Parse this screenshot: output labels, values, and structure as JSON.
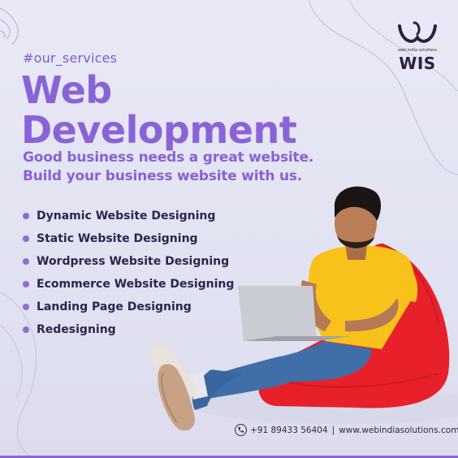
{
  "hashtag": "#our_services",
  "title": {
    "line1": "Web",
    "line2": "Development"
  },
  "tagline": {
    "line1": "Good business needs a great website.",
    "line2": "Build your business website with us."
  },
  "services": [
    "Dynamic Website Designing",
    "Static Website Designing",
    "Wordpress Website Designing",
    "Ecommerce Website Designing",
    "Landing Page Designing",
    "Redesigning"
  ],
  "logo": {
    "tagline": "web india solutions",
    "name": "WIS"
  },
  "contact": {
    "phone": "+91 89433 56404",
    "separator": "|",
    "website": "www.webindiasolutions.com"
  },
  "colors": {
    "accent": "#8a63d8",
    "text_dark": "#2b2550",
    "beanbag": "#e8202a",
    "shirt": "#f8c21a",
    "jeans": "#3f6ea8"
  },
  "icons": {
    "phone": "phone-icon",
    "bullet": "bullet-dot-icon"
  }
}
